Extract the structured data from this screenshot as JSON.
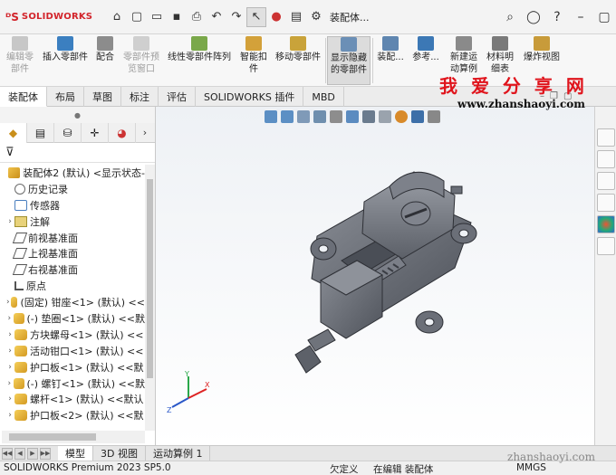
{
  "app": {
    "brand": "SOLIDWORKS",
    "doc_title": "装配体..."
  },
  "ribbon": {
    "items": [
      {
        "label1": "编辑零",
        "label2": "部件",
        "disabled": true
      },
      {
        "label1": "插入零部件",
        "label2": "",
        "disabled": false
      },
      {
        "label1": "配合",
        "label2": "",
        "disabled": false
      },
      {
        "label1": "零部件预",
        "label2": "览窗口",
        "disabled": true
      },
      {
        "label1": "线性零部件阵列",
        "label2": "",
        "disabled": false
      },
      {
        "label1": "智能扣",
        "label2": "件",
        "disabled": false
      },
      {
        "label1": "移动零部件",
        "label2": "",
        "disabled": false
      },
      {
        "label1": "显示隐藏",
        "label2": "的零部件",
        "disabled": false
      },
      {
        "label1": "装配...",
        "label2": "",
        "disabled": false
      },
      {
        "label1": "参考...",
        "label2": "",
        "disabled": false
      },
      {
        "label1": "新建运",
        "label2": "动算例",
        "disabled": false
      },
      {
        "label1": "材料明",
        "label2": "细表",
        "disabled": false
      },
      {
        "label1": "爆炸视图",
        "label2": "",
        "disabled": false
      }
    ]
  },
  "tabs": [
    "装配体",
    "布局",
    "草图",
    "标注",
    "评估",
    "SOLIDWORKS 插件",
    "MBD"
  ],
  "tree": {
    "root": "装配体2 (默认) <显示状态-",
    "items": [
      {
        "label": "历史记录",
        "icon": "history-icon",
        "expand": ""
      },
      {
        "label": "传感器",
        "icon": "sensor-icon",
        "expand": ""
      },
      {
        "label": "注解",
        "icon": "annotation-icon",
        "expand": "›"
      },
      {
        "label": "前视基准面",
        "icon": "plane-icon",
        "expand": ""
      },
      {
        "label": "上视基准面",
        "icon": "plane-icon",
        "expand": ""
      },
      {
        "label": "右视基准面",
        "icon": "plane-icon",
        "expand": ""
      },
      {
        "label": "原点",
        "icon": "origin-icon",
        "expand": ""
      },
      {
        "label": "(固定) 钳座<1> (默认) <<",
        "icon": "part-icon",
        "expand": "›"
      },
      {
        "label": "(-) 垫圈<1> (默认) <<默",
        "icon": "part-icon",
        "expand": "›"
      },
      {
        "label": "方块螺母<1> (默认) <<",
        "icon": "part-icon",
        "expand": "›"
      },
      {
        "label": "活动钳口<1> (默认) <<",
        "icon": "part-icon",
        "expand": "›"
      },
      {
        "label": "护口板<1> (默认) <<默",
        "icon": "part-icon",
        "expand": "›"
      },
      {
        "label": "(-) 螺钉<1> (默认) <<默",
        "icon": "part-icon",
        "expand": "›"
      },
      {
        "label": "螺杆<1> (默认) <<默认",
        "icon": "part-icon",
        "expand": "›"
      },
      {
        "label": "护口板<2> (默认) <<默",
        "icon": "part-icon",
        "expand": "›"
      }
    ]
  },
  "bottom_tabs": [
    "模型",
    "3D 视图",
    "运动算例 1"
  ],
  "status": {
    "product": "SOLIDWORKS Premium 2023 SP5.0",
    "state": "欠定义",
    "mode": "在编辑 装配体",
    "units": "MMGS"
  },
  "watermark": {
    "title": "我 爱 分 享 网",
    "url": "www.zhanshaoyi.com",
    "url_bottom": "zhanshaoyi.com"
  },
  "colors": {
    "brand_red": "#d2232a",
    "part_gray": "#6b6f78",
    "watermark_red": "#e0141c"
  }
}
